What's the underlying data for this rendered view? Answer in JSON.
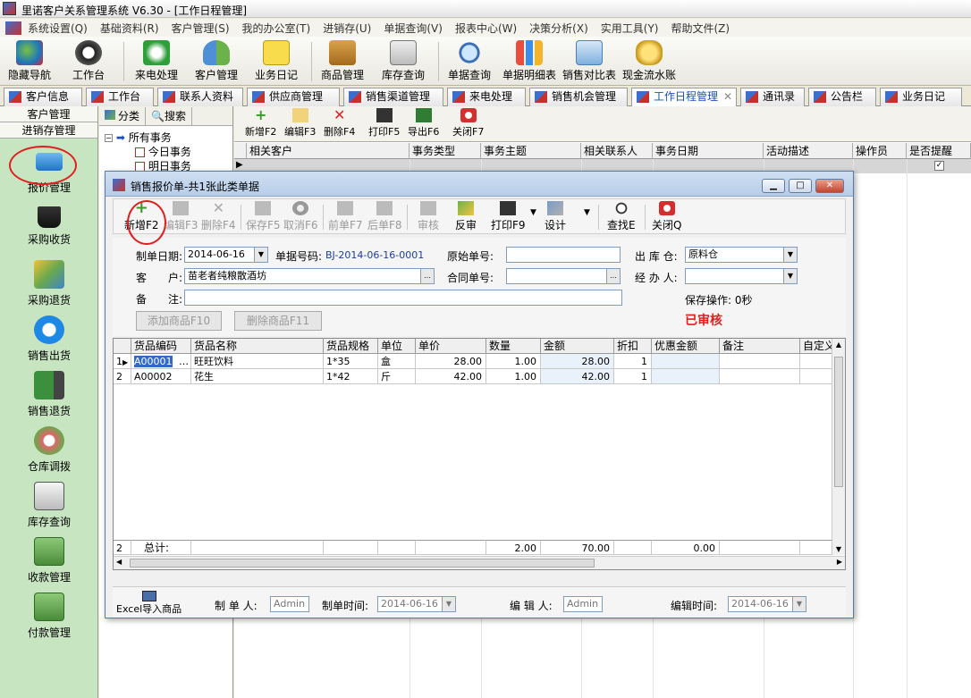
{
  "window": {
    "title": "里诺客户关系管理系统 V6.30 - [工作日程管理]"
  },
  "menu": [
    "系统设置(Q)",
    "基础资料(R)",
    "客户管理(S)",
    "我的办公室(T)",
    "进销存(U)",
    "单据查询(V)",
    "报表中心(W)",
    "决策分析(X)",
    "实用工具(Y)",
    "帮助文件(Z)"
  ],
  "toolbar": [
    {
      "label": "隐藏导航",
      "icon": "nav-icon"
    },
    {
      "label": "工作台",
      "icon": "clock-icon"
    },
    {
      "label": "来电处理",
      "icon": "phone-icon"
    },
    {
      "label": "客户管理",
      "icon": "users-icon"
    },
    {
      "label": "业务日记",
      "icon": "note-icon"
    },
    {
      "label": "商品管理",
      "icon": "box-icon"
    },
    {
      "label": "库存查询",
      "icon": "stock-icon"
    },
    {
      "label": "单据查询",
      "icon": "magnifier-icon"
    },
    {
      "label": "单据明细表",
      "icon": "bars-icon"
    },
    {
      "label": "销售对比表",
      "icon": "chart-icon"
    },
    {
      "label": "现金流水账",
      "icon": "coins-icon"
    }
  ],
  "tabs": [
    {
      "label": "客户信息"
    },
    {
      "label": "工作台"
    },
    {
      "label": "联系人资料"
    },
    {
      "label": "供应商管理"
    },
    {
      "label": "销售渠道管理"
    },
    {
      "label": "来电处理"
    },
    {
      "label": "销售机会管理"
    },
    {
      "label": "工作日程管理",
      "close": "✕"
    },
    {
      "label": "通讯录"
    },
    {
      "label": "公告栏"
    },
    {
      "label": "业务日记"
    }
  ],
  "sidebar": {
    "header1": "客户管理",
    "header2": "进销存管理",
    "items": [
      {
        "label": "报价管理"
      },
      {
        "label": "采购收货"
      },
      {
        "label": "采购退货"
      },
      {
        "label": "销售出货"
      },
      {
        "label": "销售退货"
      },
      {
        "label": "仓库调拨"
      },
      {
        "label": "库存查询"
      },
      {
        "label": "收款管理"
      },
      {
        "label": "付款管理"
      }
    ]
  },
  "tree": {
    "tab_classify": "分类",
    "tab_search": "搜索",
    "root": "所有事务",
    "children": [
      "今日事务",
      "明日事务"
    ]
  },
  "main": {
    "buttons": [
      "新增F2",
      "编辑F3",
      "删除F4",
      "打印F5",
      "导出F6",
      "关闭F7"
    ],
    "columns": [
      "相关客户",
      "事务类型",
      "事务主题",
      "相关联系人",
      "事务日期",
      "活动描述",
      "操作员",
      "是否提醒"
    ]
  },
  "dialog": {
    "title": "销售报价单-共1张此类单据",
    "buttons": [
      {
        "label": "新增F2",
        "enabled": true
      },
      {
        "label": "编辑F3",
        "enabled": false
      },
      {
        "label": "删除F4",
        "enabled": false
      },
      {
        "label": "保存F5",
        "enabled": false
      },
      {
        "label": "取消F6",
        "enabled": false
      },
      {
        "label": "前单F7",
        "enabled": false
      },
      {
        "label": "后单F8",
        "enabled": false
      },
      {
        "label": "审核",
        "enabled": false
      },
      {
        "label": "反审",
        "enabled": true
      },
      {
        "label": "打印F9",
        "enabled": true
      },
      {
        "label": "设计",
        "enabled": true
      },
      {
        "label": "查找E",
        "enabled": true
      },
      {
        "label": "关闭Q",
        "enabled": true
      }
    ],
    "form": {
      "date_label": "制单日期:",
      "date_value": "2014-06-16",
      "docno_label": "单据号码:",
      "docno_value": "BJ-2014-06-16-0001",
      "orig_label": "原始单号:",
      "orig_value": "",
      "warehouse_label": "出 库 仓:",
      "warehouse_value": "原料仓",
      "customer_label": "客　　户:",
      "customer_value": "苗老者纯粮散酒坊",
      "contract_label": "合同单号:",
      "contract_value": "",
      "handler_label": "经 办 人:",
      "handler_value": "",
      "note_label": "备　　注:",
      "note_value": "",
      "save_op": "保存操作: 0秒",
      "status": "已审核",
      "add_goods": "添加商品F10",
      "del_goods": "删除商品F11"
    },
    "grid": {
      "columns": [
        "货品编码",
        "货品名称",
        "货品规格",
        "单位",
        "单价",
        "数量",
        "金额",
        "折扣",
        "优惠金额",
        "备注",
        "自定义"
      ],
      "rows": [
        {
          "idx": "1",
          "code": "A00001",
          "name": "旺旺饮料",
          "spec": "1*35",
          "unit": "盒",
          "price": "28.00",
          "qty": "1.00",
          "amount": "28.00",
          "disc": "1"
        },
        {
          "idx": "2",
          "code": "A00002",
          "name": "花生",
          "spec": "1*42",
          "unit": "斤",
          "price": "42.00",
          "qty": "1.00",
          "amount": "42.00",
          "disc": "1"
        }
      ],
      "footer": {
        "count": "2",
        "label": "总计:",
        "qty": "2.00",
        "amount": "70.00",
        "discount_amount": "0.00"
      }
    },
    "bottom": {
      "excel_label": "Excel导入商品",
      "maker_label": "制 单 人:",
      "maker": "Admin",
      "make_time_label": "制单时间:",
      "make_time": "2014-06-16",
      "editor_label": "编 辑 人:",
      "editor": "Admin",
      "edit_time_label": "编辑时间:",
      "edit_time": "2014-06-16"
    }
  }
}
